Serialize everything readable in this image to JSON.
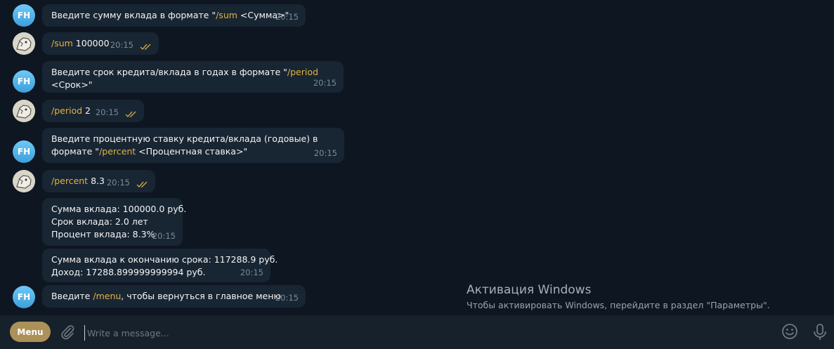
{
  "bot": {
    "initials": "FH"
  },
  "messages": [
    {
      "from": "bot",
      "parts": [
        "Введите сумму вклада в формате \"",
        "/sum",
        " <Сумма>\""
      ],
      "time": "20:15"
    },
    {
      "from": "user",
      "cmd": "/sum",
      "arg": " 100000",
      "time": "20:15"
    },
    {
      "from": "bot",
      "parts": [
        "Введите срок кредита/вклада в годах в формате \"",
        "/period",
        " <Срок>\""
      ],
      "time": "20:15"
    },
    {
      "from": "user",
      "cmd": "/period",
      "arg": " 2",
      "time": "20:15"
    },
    {
      "from": "bot",
      "line1": "Введите процентную ставку кредита/вклада (годовые) в",
      "parts": [
        "формате \"",
        "/percent",
        " <Процентная ставка>\""
      ],
      "time": "20:15"
    },
    {
      "from": "user",
      "cmd": "/percent",
      "arg": " 8.3",
      "time": "20:15"
    },
    {
      "from": "bot",
      "lines": [
        "Сумма вклада: 100000.0 руб.",
        "Срок вклада: 2.0 лет",
        "Процент вклада: 8.3%"
      ],
      "time": "20:15"
    },
    {
      "from": "bot",
      "lines": [
        "Сумма вклада к окончанию срока: 117288.9 руб.",
        "Доход: 17288.899999999994 руб."
      ],
      "time": "20:15"
    },
    {
      "from": "bot",
      "parts": [
        "Введите ",
        "/menu",
        ", чтобы вернуться в главное меню"
      ],
      "time": "20:15"
    }
  ],
  "watermark": {
    "title": "Активация Windows",
    "subtitle": "Чтобы активировать Windows, перейдите в раздел \"Параметры\"."
  },
  "input_bar": {
    "menu_label": "Menu",
    "placeholder": "Write a message..."
  },
  "colors": {
    "command": "#e3b341",
    "menu_button": "#ac9158",
    "bot_avatar": "#4aaee8"
  },
  "icons": [
    "attach-icon",
    "emoji-icon",
    "microphone-icon",
    "double-check-icon"
  ]
}
